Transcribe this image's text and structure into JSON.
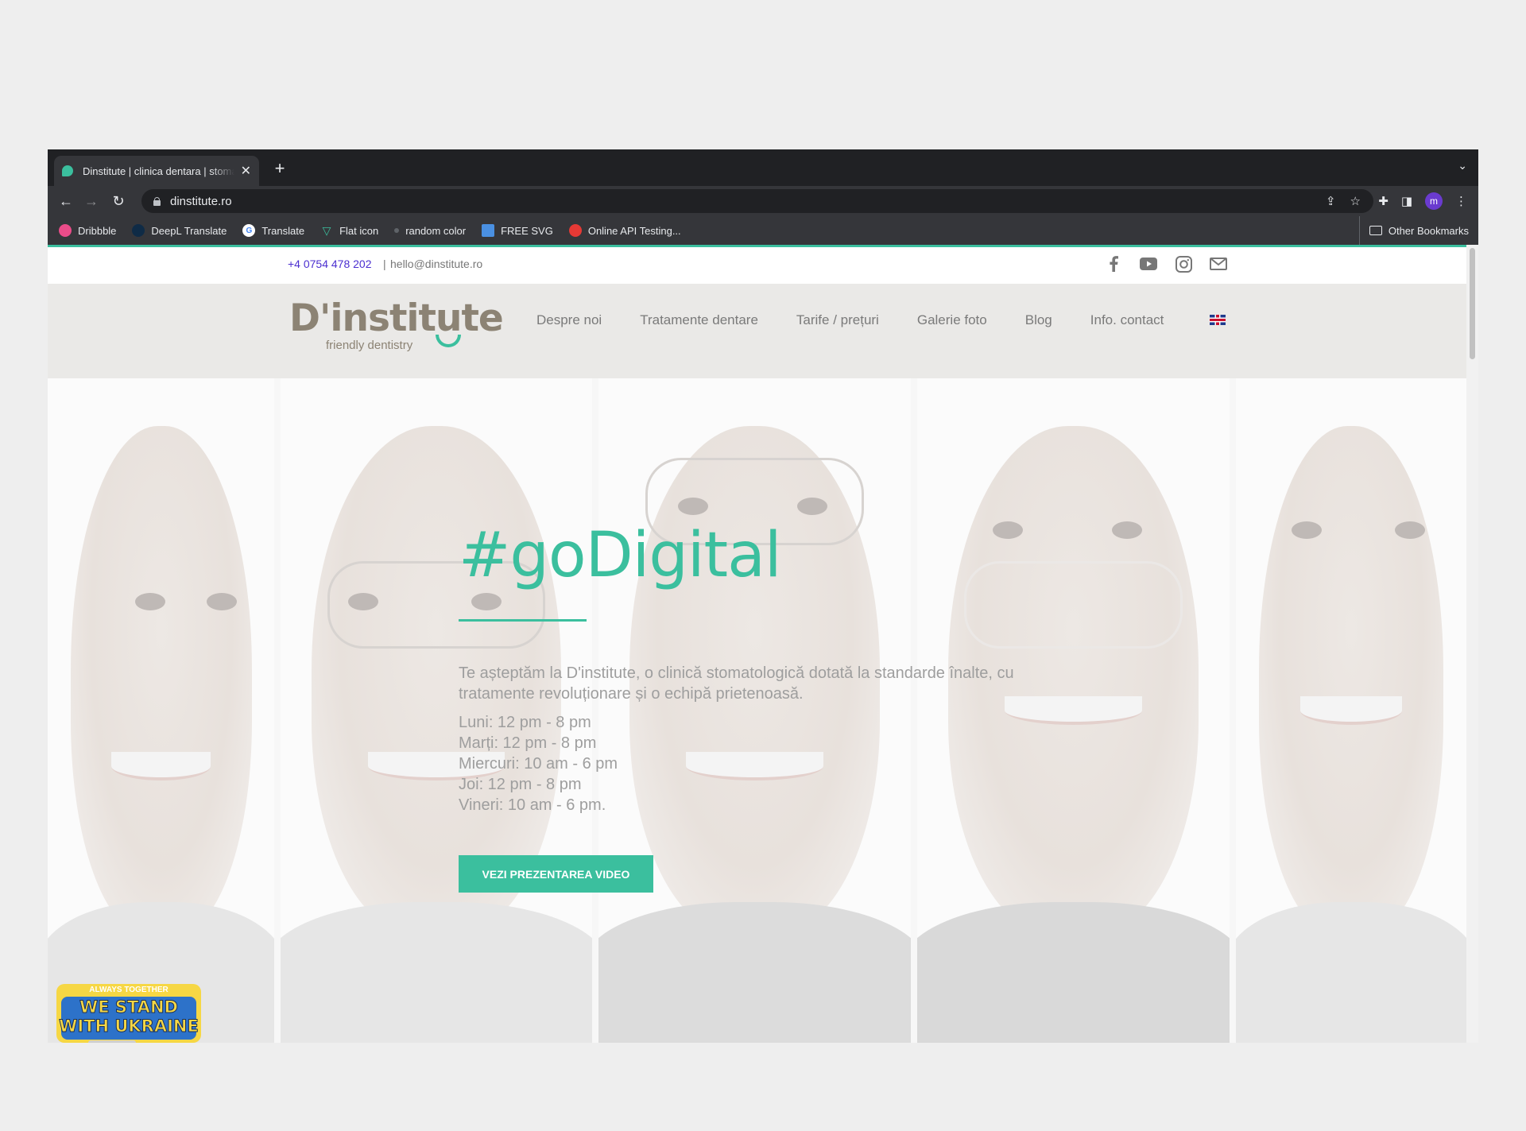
{
  "browser": {
    "tab_title": "Dinstitute | clinica dentara | stomatologie",
    "new_tab": "+",
    "url": "dinstitute.ro",
    "profile_initial": "m",
    "bookmarks": [
      {
        "label": "Dribbble",
        "color": "#ea4c89"
      },
      {
        "label": "DeepL Translate",
        "color": "#0f2b46"
      },
      {
        "label": "Translate",
        "color": "#ffffff"
      },
      {
        "label": "Flat icon",
        "color": "#3bbf9e"
      },
      {
        "label": "random color",
        "color": "#5f6368"
      },
      {
        "label": "FREE SVG",
        "color": "#4a90e2"
      },
      {
        "label": "Online API Testing...",
        "color": "#e53935"
      }
    ],
    "other_bookmarks": "Other Bookmarks"
  },
  "topbar": {
    "phone": "+4 0754 478 202",
    "separator": "|",
    "email": "hello@dinstitute.ro",
    "socials": [
      "facebook-icon",
      "youtube-icon",
      "instagram-icon",
      "mail-icon"
    ]
  },
  "header": {
    "logo_main": "D'institute",
    "logo_sub": "friendly dentistry",
    "menu": [
      "Despre noi",
      "Tratamente dentare",
      "Tarife / prețuri",
      "Galerie foto",
      "Blog",
      "Info. contact"
    ],
    "language": "uk-flag-icon"
  },
  "hero": {
    "title": "#goDigital",
    "text": "Te așteptăm la D'institute, o clinică stomatologică dotată la standarde înalte, cu tratamente revoluționare și o echipă prietenoasă.",
    "hours": [
      "Luni: 12 pm - 8 pm",
      "Marți: 12 pm - 8 pm",
      "Miercuri: 10 am - 6 pm",
      "Joi: 12 pm - 8 pm",
      "Vineri: 10 am - 6 pm."
    ],
    "cta": "VEZI PREZENTAREA VIDEO",
    "accent": "#3bbf9e"
  },
  "badge": {
    "top": "ALWAYS TOGETHER",
    "line1": "WE STAND",
    "line2": "WITH UKRAINE"
  }
}
